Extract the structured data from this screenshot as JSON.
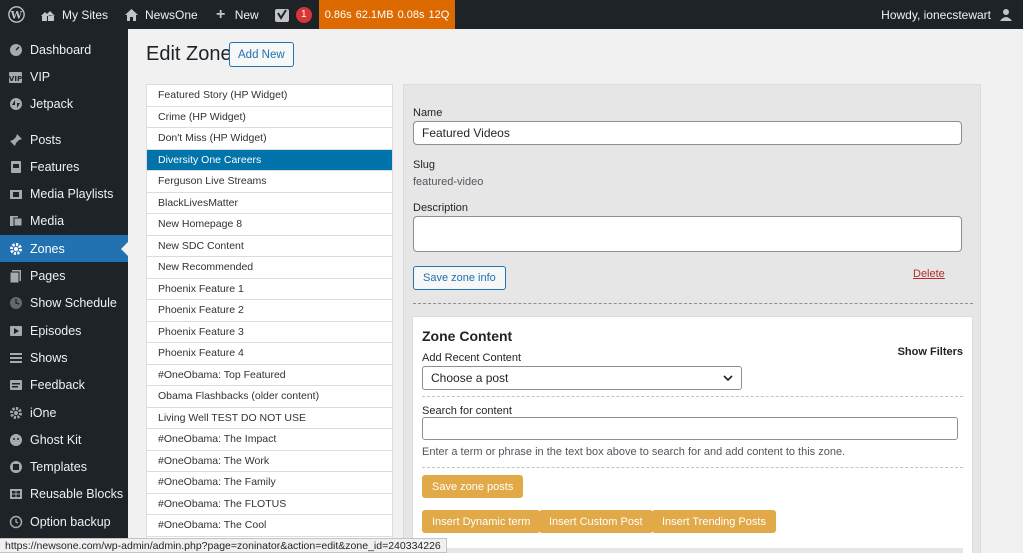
{
  "adminbar": {
    "my_sites": "My Sites",
    "site_name": "NewsOne",
    "new_label": "New",
    "notif_count": "1",
    "perf": [
      "0.86s",
      "62.1MB",
      "0.08s",
      "12Q"
    ],
    "howdy": "Howdy, ionecstewart"
  },
  "sidebar": {
    "items": [
      {
        "label": "Dashboard",
        "icon": "dashboard-icon"
      },
      {
        "label": "VIP",
        "icon": "vip-icon"
      },
      {
        "label": "Jetpack",
        "icon": "jetpack-icon"
      },
      {
        "label": "Posts",
        "icon": "pin-icon"
      },
      {
        "label": "Features",
        "icon": "features-icon"
      },
      {
        "label": "Media Playlists",
        "icon": "playlist-icon"
      },
      {
        "label": "Media",
        "icon": "media-icon"
      },
      {
        "label": "Zones",
        "icon": "gear-icon"
      },
      {
        "label": "Pages",
        "icon": "pages-icon"
      },
      {
        "label": "Show Schedule",
        "icon": "clock-icon"
      },
      {
        "label": "Episodes",
        "icon": "play-icon"
      },
      {
        "label": "Shows",
        "icon": "list-icon"
      },
      {
        "label": "Feedback",
        "icon": "feedback-icon"
      },
      {
        "label": "iOne",
        "icon": "gear-icon"
      },
      {
        "label": "Ghost Kit",
        "icon": "ghost-icon"
      },
      {
        "label": "Templates",
        "icon": "templates-icon"
      },
      {
        "label": "Reusable Blocks",
        "icon": "blocks-icon"
      },
      {
        "label": "Option backup",
        "icon": "backup-icon"
      }
    ]
  },
  "main": {
    "title": "Edit Zone",
    "add_new": "Add New"
  },
  "zones": [
    "Featured Story (HP Widget)",
    "Crime (HP Widget)",
    "Don't Miss (HP Widget)",
    "Diversity One Careers",
    "Ferguson Live Streams",
    "BlackLivesMatter",
    "New Homepage 8",
    "New SDC Content",
    "New Recommended",
    "Phoenix Feature 1",
    "Phoenix Feature 2",
    "Phoenix Feature 3",
    "Phoenix Feature 4",
    "#OneObama: Top Featured",
    "Obama Flashbacks (older content)",
    "Living Well TEST DO NOT USE",
    "#OneObama: The Impact",
    "#OneObama: The Work",
    "#OneObama: The Family",
    "#OneObama: The FLOTUS",
    "#OneObama: The Cool"
  ],
  "form": {
    "name_label": "Name",
    "name_value": "Featured Videos",
    "slug_label": "Slug",
    "slug_value": "featured-video",
    "description_label": "Description",
    "description_value": "",
    "save_info": "Save zone info",
    "delete": "Delete"
  },
  "content": {
    "title": "Zone Content",
    "show_filters": "Show Filters",
    "add_recent_label": "Add Recent Content",
    "select_value": "Choose a post",
    "search_label": "Search for content",
    "search_value": "",
    "hint": "Enter a term or phrase in the text box above to search for and add content to this zone.",
    "save_posts": "Save zone posts",
    "insert_dynamic": "Insert Dynamic term",
    "insert_custom": "Insert Custom Post",
    "insert_trending": "Insert Trending Posts"
  },
  "status_url": "https://newsone.com/wp-admin/admin.php?page=zoninator&action=edit&zone_id=240334226"
}
